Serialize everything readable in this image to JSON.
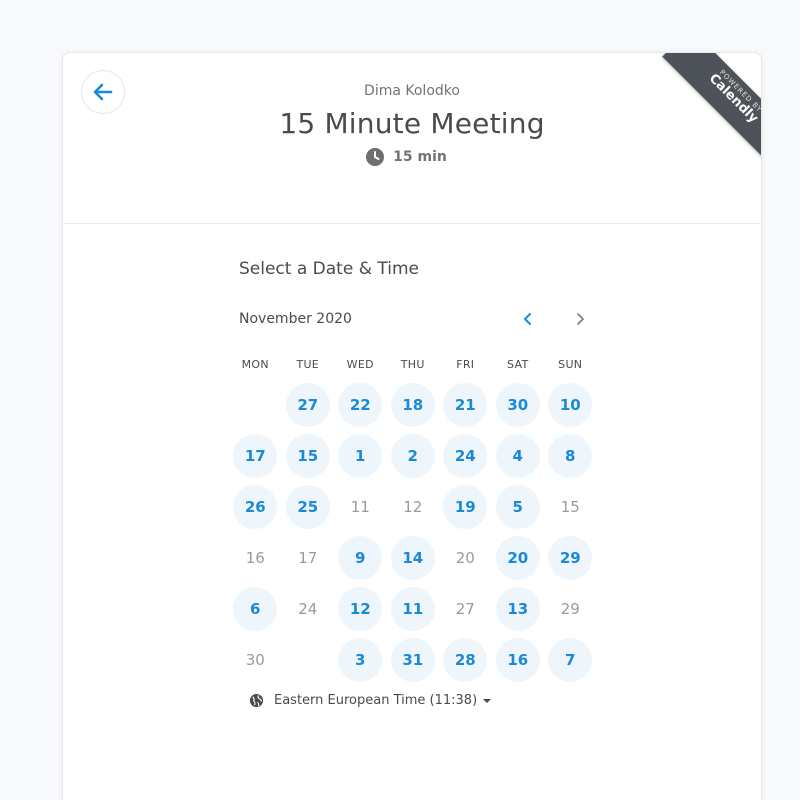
{
  "header": {
    "organizer": "Dima Kolodko",
    "title": "15 Minute Meeting",
    "duration": "15 min"
  },
  "ribbon": {
    "powered_by": "POWERED BY",
    "brand": "Calendly"
  },
  "scheduler": {
    "heading": "Select a Date & Time",
    "month": "November 2020",
    "weekdays": [
      "MON",
      "TUE",
      "WED",
      "THU",
      "FRI",
      "SAT",
      "SUN"
    ],
    "weeks": [
      [
        {
          "label": "",
          "available": false
        },
        {
          "label": "27",
          "available": true
        },
        {
          "label": "22",
          "available": true
        },
        {
          "label": "18",
          "available": true
        },
        {
          "label": "21",
          "available": true
        },
        {
          "label": "30",
          "available": true
        },
        {
          "label": "10",
          "available": true
        }
      ],
      [
        {
          "label": "17",
          "available": true
        },
        {
          "label": "15",
          "available": true
        },
        {
          "label": "1",
          "available": true
        },
        {
          "label": "2",
          "available": true
        },
        {
          "label": "24",
          "available": true
        },
        {
          "label": "4",
          "available": true
        },
        {
          "label": "8",
          "available": true
        }
      ],
      [
        {
          "label": "26",
          "available": true
        },
        {
          "label": "25",
          "available": true
        },
        {
          "label": "11",
          "available": false
        },
        {
          "label": "12",
          "available": false
        },
        {
          "label": "19",
          "available": true
        },
        {
          "label": "5",
          "available": true
        },
        {
          "label": "15",
          "available": false
        }
      ],
      [
        {
          "label": "16",
          "available": false
        },
        {
          "label": "17",
          "available": false
        },
        {
          "label": "9",
          "available": true
        },
        {
          "label": "14",
          "available": true
        },
        {
          "label": "20",
          "available": false
        },
        {
          "label": "20",
          "available": true
        },
        {
          "label": "29",
          "available": true
        }
      ],
      [
        {
          "label": "6",
          "available": true
        },
        {
          "label": "24",
          "available": false
        },
        {
          "label": "12",
          "available": true
        },
        {
          "label": "11",
          "available": true
        },
        {
          "label": "27",
          "available": false
        },
        {
          "label": "13",
          "available": true
        },
        {
          "label": "29",
          "available": false
        }
      ],
      [
        {
          "label": "30",
          "available": false
        },
        {
          "label": "",
          "available": false
        },
        {
          "label": "3",
          "available": true
        },
        {
          "label": "31",
          "available": true
        },
        {
          "label": "28",
          "available": true
        },
        {
          "label": "16",
          "available": true
        },
        {
          "label": "7",
          "available": true
        }
      ]
    ],
    "timezone": "Eastern European Time (11:38)"
  },
  "colors": {
    "accent": "#1a8ad6",
    "available_bg": "#eef6fc",
    "text": "#4b4b4b",
    "muted": "#9a9a9a",
    "ribbon": "#4e5359"
  },
  "icons": {
    "back": "arrow-left-icon",
    "clock": "clock-icon",
    "prev": "chevron-left-icon",
    "next": "chevron-right-icon",
    "globe": "globe-icon",
    "dropdown": "caret-down-icon"
  }
}
